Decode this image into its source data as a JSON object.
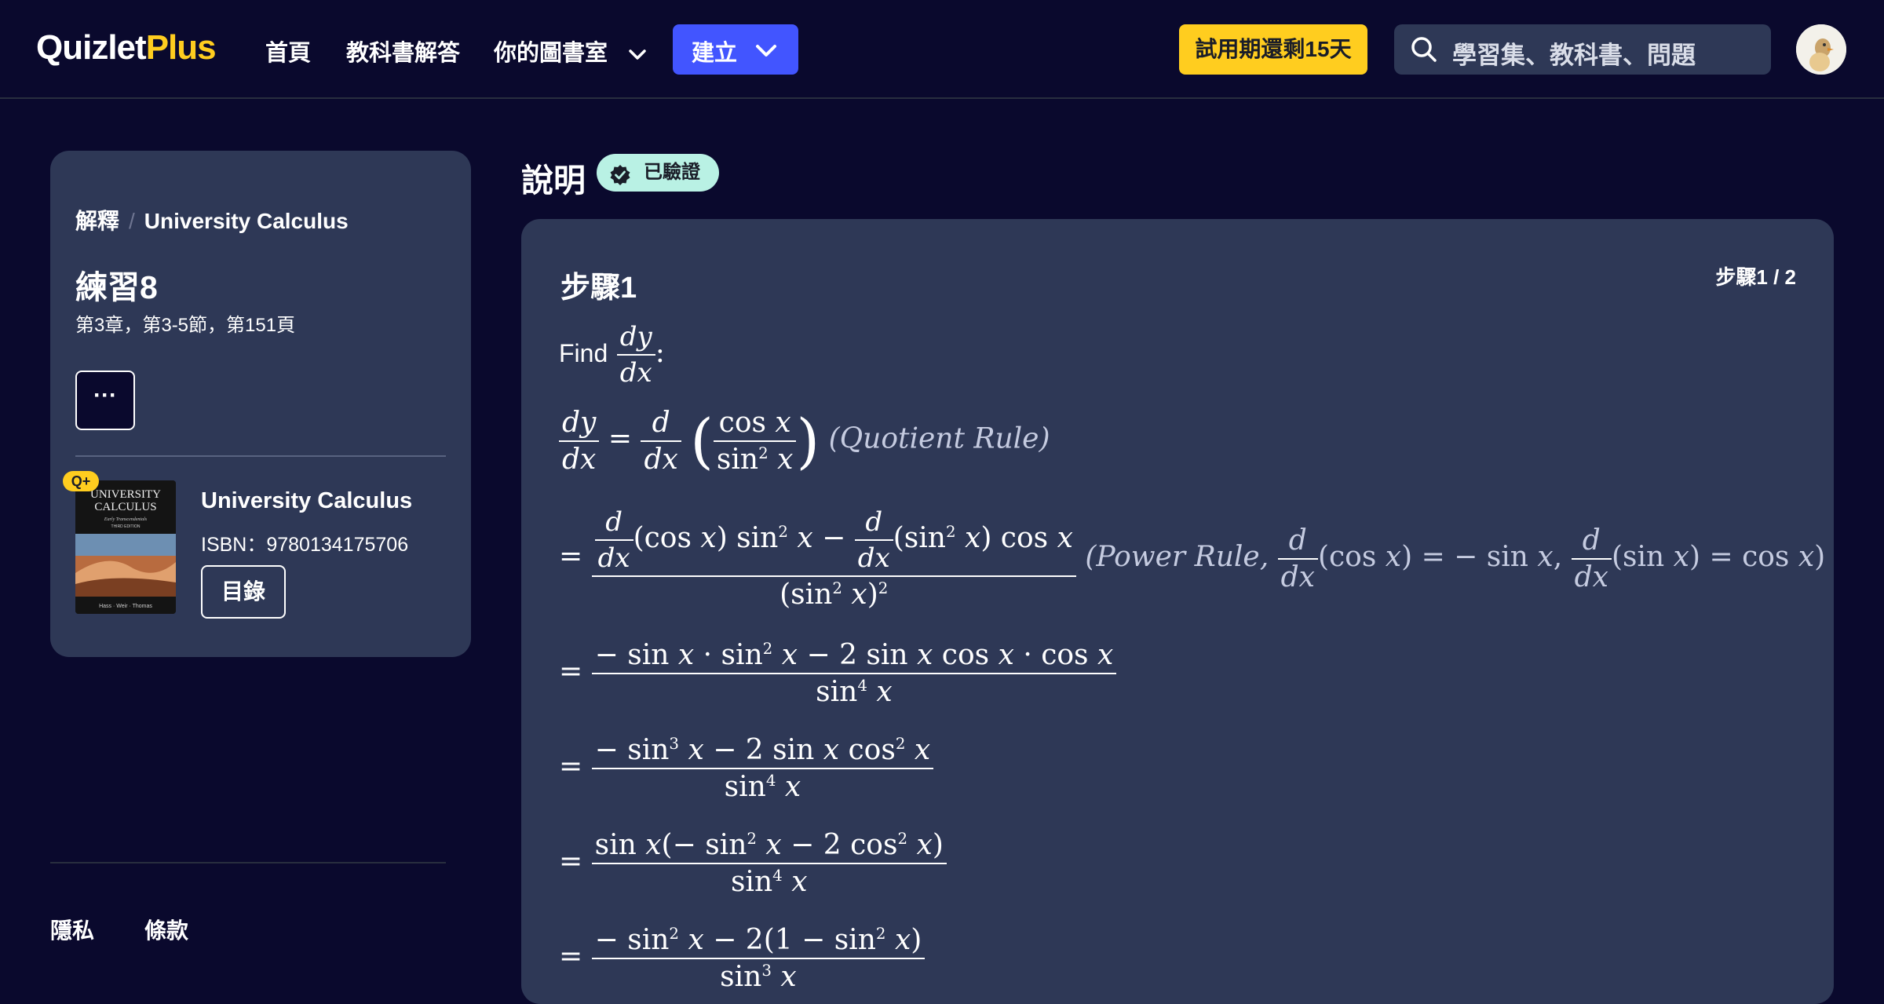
{
  "header": {
    "logo_main": "Quizlet",
    "logo_plus": "Plus",
    "nav": {
      "home": "首頁",
      "textbook_solutions": "教科書解答",
      "library": "你的圖書室"
    },
    "create_label": "建立",
    "trial_label": "試用期還剩15天",
    "search_placeholder": "學習集、教科書、問題"
  },
  "sidebar": {
    "breadcrumb_root": "解釋",
    "breadcrumb_sep": "/",
    "breadcrumb_book": "University Calculus",
    "exercise_title": "練習8",
    "exercise_location": "第3章，第3-5節，第151頁",
    "more_label": "···",
    "book_badge": "Q+",
    "book_title": "University Calculus",
    "book_isbn": "ISBN：9780134175706",
    "toc_label": "目錄",
    "cover_text": {
      "line1": "UNIVERSITY",
      "line2": "CALCULUS",
      "line3": "Early Transcendentals",
      "line4": "THIRD EDITION",
      "authors": "Hass · Weir · Thomas"
    }
  },
  "footer": {
    "privacy": "隱私",
    "terms": "條款"
  },
  "explanation": {
    "title": "說明",
    "verified_label": "已驗證",
    "step_title": "步驟1",
    "step_counter": "步驟1 / 2",
    "find_label": "Find",
    "quotient_note": "(Quotient Rule)",
    "power_note_prefix": "(Power Rule,"
  },
  "colors": {
    "background": "#0a092d",
    "card": "#2e3856",
    "accent_blue": "#4255ff",
    "accent_yellow": "#ffcd1f",
    "verified_bg": "#b9f1e4"
  },
  "icons": [
    "chevron-down-icon",
    "search-icon",
    "verified-check-icon"
  ]
}
